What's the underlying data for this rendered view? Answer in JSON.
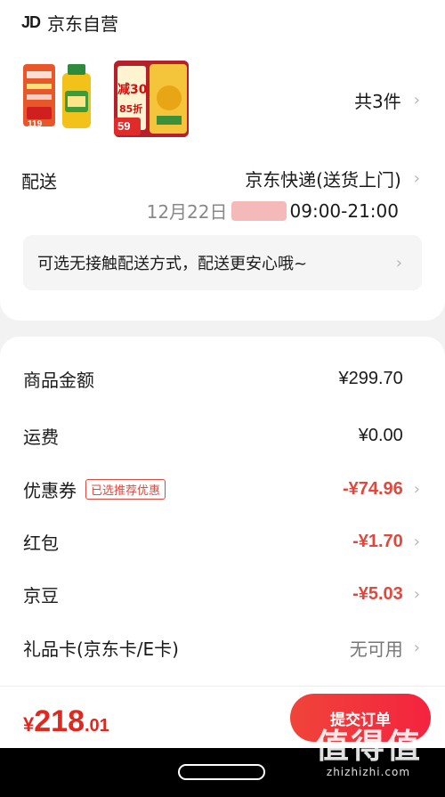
{
  "shop": {
    "logo": "JD",
    "name": "京东自营"
  },
  "products": {
    "item_count": "共3件",
    "thumb1": {
      "badge": "119"
    },
    "thumb2": {
      "headline": "减30",
      "discount": "85折",
      "price": "59"
    }
  },
  "delivery": {
    "label": "配送",
    "method": "京东快递(送货上门)",
    "time_prefix": "12月22日",
    "time_suffix": "09:00-21:00"
  },
  "tip": {
    "text": "可选无接触配送方式，配送更安心哦~"
  },
  "summary": {
    "rows": [
      {
        "label": "商品金额",
        "value": "¥299.70"
      },
      {
        "label": "运费",
        "value": "¥0.00"
      },
      {
        "label": "优惠券",
        "tag": "已选推荐优惠",
        "value": "-¥74.96"
      },
      {
        "label": "红包",
        "value": "-¥1.70"
      },
      {
        "label": "京豆",
        "value": "-¥5.03"
      },
      {
        "label": "礼品卡(京东卡/E卡)",
        "value": "无可用"
      }
    ]
  },
  "footer": {
    "currency": "¥",
    "total_int": "218",
    "total_dec": ".01",
    "submit_label": "提交订单"
  },
  "watermark": {
    "logo": "值得值",
    "site": "zhizhizhi.com"
  },
  "colors": {
    "accent": "#e0483e",
    "button": "#f0443a"
  }
}
